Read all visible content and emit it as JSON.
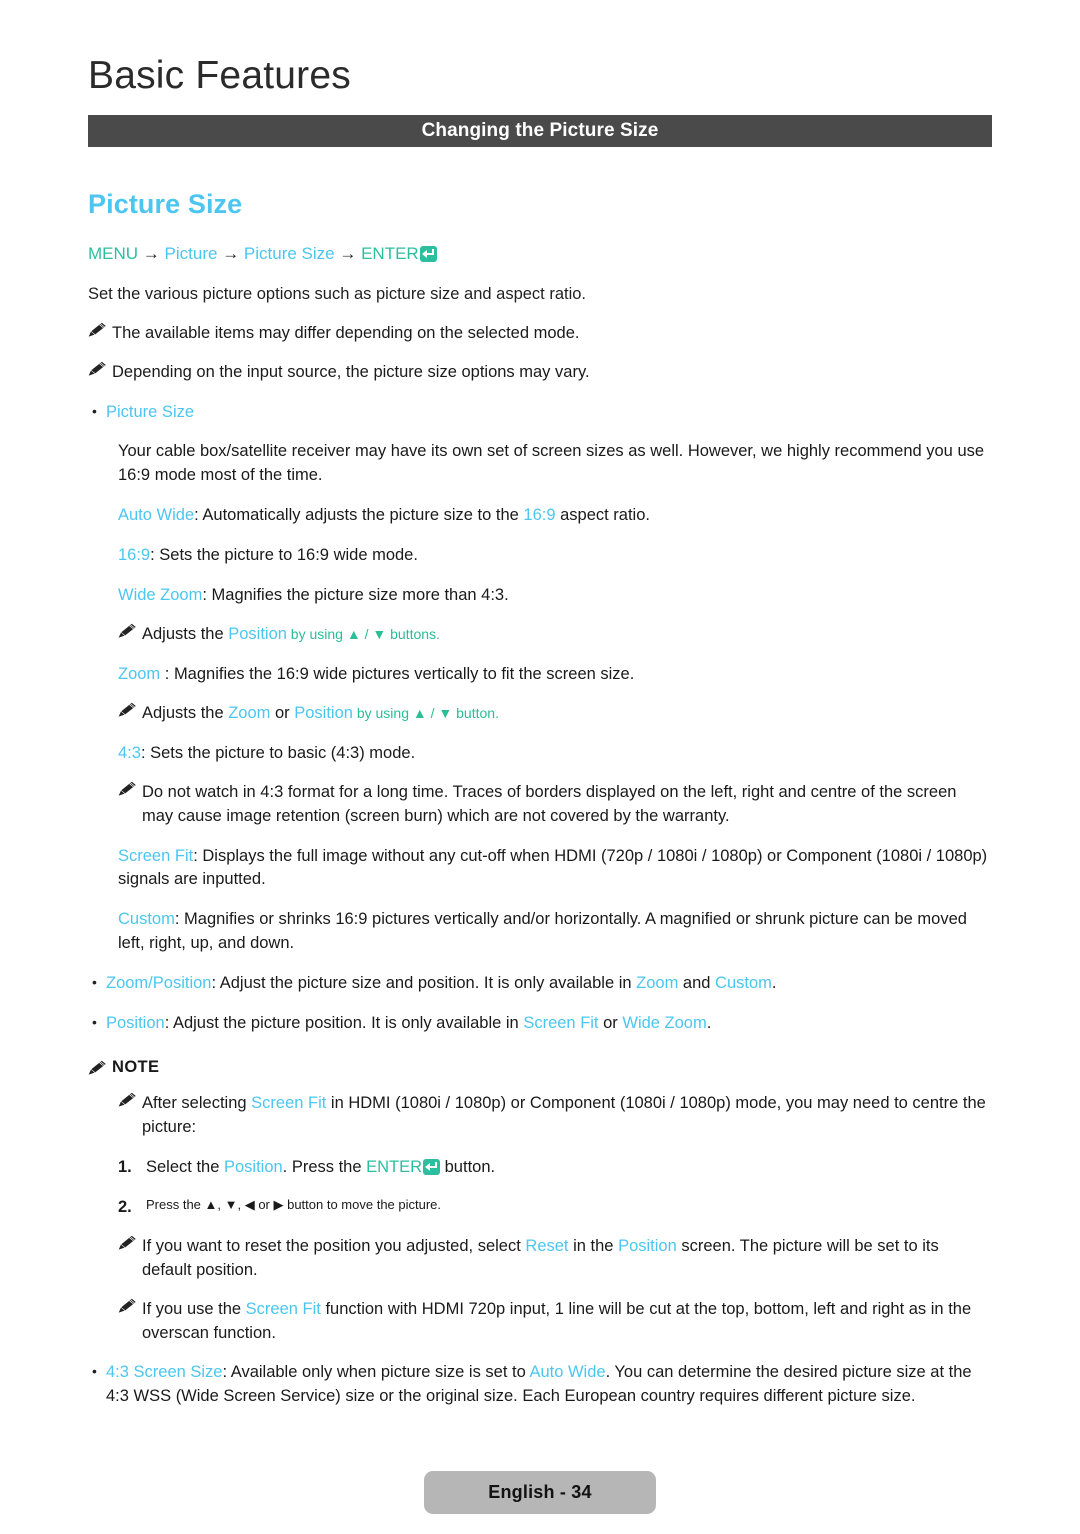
{
  "chapter": {
    "title": "Basic Features"
  },
  "section_bar": {
    "title": "Changing the Picture Size"
  },
  "feature": {
    "heading": "Picture Size"
  },
  "menu_path": {
    "menu": "MENU",
    "arrow": "→",
    "step1": "Picture",
    "step2": "Picture Size",
    "enter": "ENTER"
  },
  "intro": {
    "line": "Set the various picture options such as picture size and aspect ratio.",
    "note1": "The available items may differ depending on the selected mode.",
    "note2": "Depending on the input source, the picture size options may vary."
  },
  "picture_size_bullet": {
    "label": "Picture Size",
    "paragraph": "Your cable box/satellite receiver may have its own set of screen sizes as well. However, we highly recommend you use 16:9 mode most of the time.",
    "auto_wide": {
      "term": "Auto Wide",
      "text_before": ": Automatically adjusts the picture size to the ",
      "highlight": "16:9",
      "text_after": " aspect ratio."
    },
    "sixteen_nine": {
      "term": "16:9",
      "text": ": Sets the picture to 16:9 wide mode."
    },
    "wide_zoom": {
      "term": "Wide Zoom",
      "text": ": Magnifies the picture size more than 4:3."
    },
    "wide_zoom_note": {
      "before": "Adjusts the ",
      "term": "Position",
      "after": " by using ▲ / ▼ buttons."
    },
    "zoom": {
      "term": "Zoom",
      "text": " : Magnifies the 16:9 wide pictures vertically to fit the screen size."
    },
    "zoom_note": {
      "before": "Adjusts the ",
      "term1": "Zoom",
      "middle": " or ",
      "term2": "Position",
      "after": " by using ▲ / ▼ button."
    },
    "four_three": {
      "term": "4:3",
      "text": ": Sets the picture to basic (4:3) mode."
    },
    "four_three_warning": "Do not watch in 4:3 format for a long time. Traces of borders displayed on the left, right and centre of the screen may cause image retention (screen burn) which are not covered by the warranty.",
    "screen_fit": {
      "term": "Screen Fit",
      "text": ": Displays the full image without any cut-off when HDMI (720p / 1080i / 1080p) or Component (1080i / 1080p) signals are inputted."
    },
    "custom": {
      "term": "Custom",
      "text": ": Magnifies or shrinks 16:9 pictures vertically and/or horizontally. A magnified or shrunk picture can be moved left, right, up, and down."
    }
  },
  "zoom_position_bullet": {
    "term": "Zoom/Position",
    "text_1": ": Adjust the picture size and position. It is only available in ",
    "term_2": "Zoom",
    "text_2": " and ",
    "term_3": "Custom",
    "text_3": "."
  },
  "position_bullet": {
    "term": "Position",
    "text_1": ": Adjust the picture position. It is only available in ",
    "term_2": "Screen Fit",
    "text_2": " or ",
    "term_3": "Wide Zoom",
    "text_3": "."
  },
  "note_section": {
    "label": "NOTE",
    "after_selecting": {
      "before": "After selecting ",
      "term": "Screen Fit",
      "after": " in HDMI (1080i / 1080p) or Component (1080i / 1080p) mode, you may need to centre the picture:"
    },
    "steps": [
      {
        "num": "1.",
        "before": "Select the ",
        "term": "Position",
        "middle": ". Press the ",
        "enter": "ENTER",
        "after": " button."
      },
      {
        "num": "2.",
        "text": "Press the ▲, ▼, ◀ or ▶ button to move the picture."
      }
    ],
    "reset_note": {
      "before": "If you want to reset the position you adjusted, select ",
      "term1": "Reset",
      "middle": " in the ",
      "term2": "Position",
      "after": " screen. The picture will be set to its default position."
    },
    "overscan_note": {
      "before": "If you use the ",
      "term": "Screen Fit",
      "after": " function with HDMI 720p input, 1 line will be cut at the top, bottom, left and right as in the overscan function."
    }
  },
  "screen_size_bullet": {
    "term": "4:3 Screen Size",
    "text_1": ": Available only when picture size is set to ",
    "term_2": "Auto Wide",
    "text_2": ". You can determine the desired picture size at the 4:3 WSS (Wide Screen Service) size or the original size. Each European country requires different picture size."
  },
  "footer": {
    "page_label": "English - 34"
  },
  "colors": {
    "accent_blue": "#4cc6f0",
    "accent_teal": "#2bbfa0",
    "bar_gray": "#4a4a4a",
    "pill_gray": "#b6b6b6"
  }
}
